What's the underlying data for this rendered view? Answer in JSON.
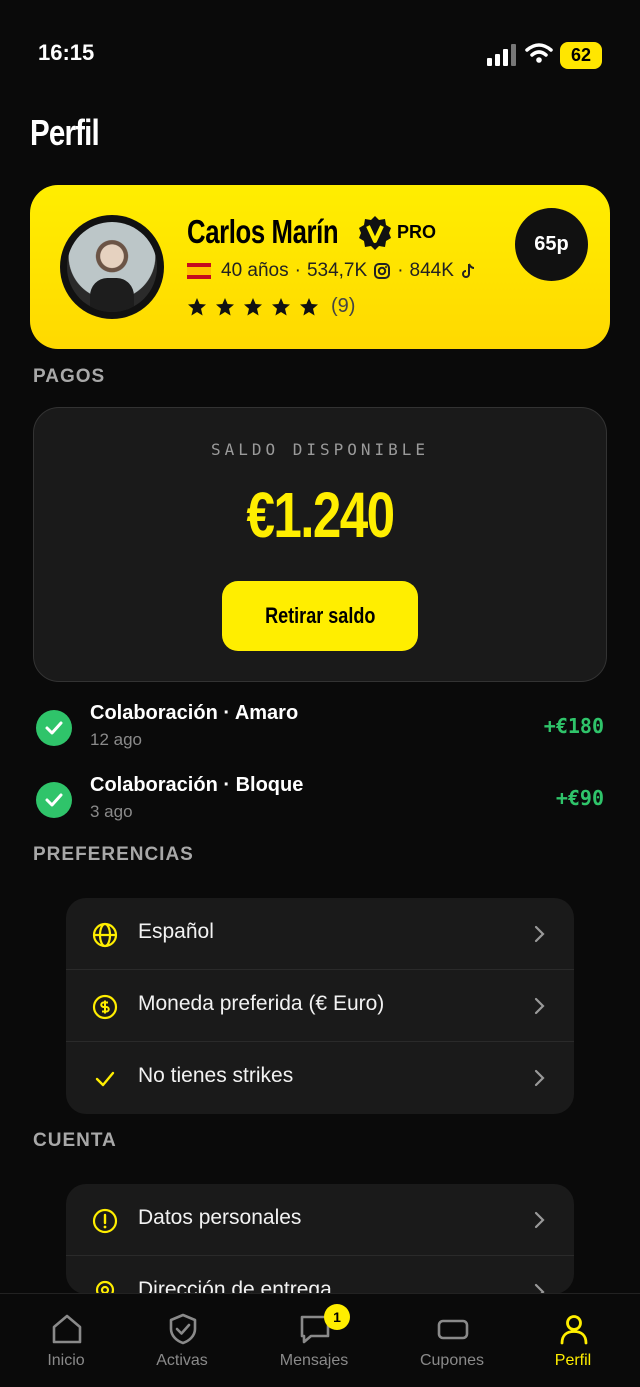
{
  "status_bar": {
    "time": "16:15",
    "battery": "62"
  },
  "page": {
    "title": "Perfil"
  },
  "profile": {
    "name": "Carlos Marín",
    "pro_label": "PRO",
    "age": "40 años",
    "instagram": "534,7K",
    "tiktok": "844K",
    "rating_stars": 5,
    "rating_count": "(9)",
    "points": "65p"
  },
  "payments": {
    "section_label": "PAGOS",
    "balance_label": "SALDO DISPONIBLE",
    "balance_amount": "€1.240",
    "withdraw_label": "Retirar saldo",
    "transactions": [
      {
        "title": "Colaboración · Amaro",
        "date": "12 ago",
        "amount": "+€180"
      },
      {
        "title": "Colaboración · Bloque",
        "date": "3 ago",
        "amount": "+€90"
      }
    ]
  },
  "preferences": {
    "section_label": "PREFERENCIAS",
    "items": [
      {
        "label": "Español",
        "icon": "globe-icon"
      },
      {
        "label": "Moneda preferida (€ Euro)",
        "icon": "coin-icon"
      },
      {
        "label": "No tienes strikes",
        "icon": "check-icon"
      }
    ]
  },
  "account": {
    "section_label": "CUENTA",
    "items": [
      {
        "label": "Datos personales",
        "icon": "info-icon"
      },
      {
        "label": "Dirección de entrega",
        "icon": "location-icon"
      }
    ]
  },
  "nav": {
    "items": [
      {
        "label": "Inicio",
        "icon": "home-icon"
      },
      {
        "label": "Activas",
        "icon": "shield-check-icon"
      },
      {
        "label": "Mensajes",
        "icon": "message-icon",
        "badge": "1"
      },
      {
        "label": "Cupones",
        "icon": "coupon-icon"
      },
      {
        "label": "Perfil",
        "icon": "user-icon",
        "active": true
      }
    ]
  },
  "colors": {
    "accent": "#ffee00",
    "success": "#2fc46a",
    "background": "#0a0a0a",
    "card": "#1a1a1a"
  }
}
